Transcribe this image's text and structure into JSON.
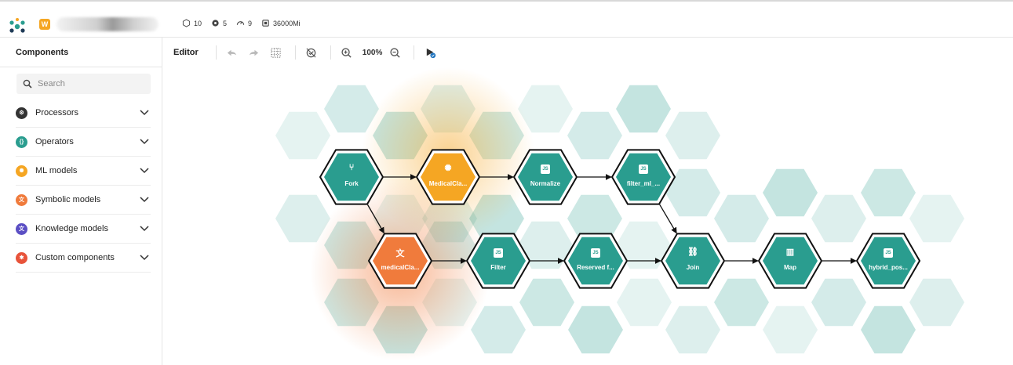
{
  "topbar": {
    "workspace_badge": "W",
    "stats": [
      {
        "icon": "hexagon-outline-icon",
        "value": "10"
      },
      {
        "icon": "gear-icon",
        "value": "5"
      },
      {
        "icon": "gauge-icon",
        "value": "9"
      },
      {
        "icon": "chip-icon",
        "value": "36000Mi"
      }
    ]
  },
  "sidebar": {
    "title": "Components",
    "search_placeholder": "Search",
    "categories": [
      {
        "label": "Processors",
        "color": "#333333",
        "icon": "gear-icon"
      },
      {
        "label": "Operators",
        "color": "#2a9d8f",
        "icon": "braces-icon"
      },
      {
        "label": "ML models",
        "color": "#f5a623",
        "icon": "brain-icon"
      },
      {
        "label": "Symbolic models",
        "color": "#f07b3c",
        "icon": "translate-icon"
      },
      {
        "label": "Knowledge models",
        "color": "#5b4fc4",
        "icon": "translate-icon"
      },
      {
        "label": "Custom components",
        "color": "#e8533a",
        "icon": "puzzle-icon"
      }
    ]
  },
  "toolbar": {
    "label": "Editor",
    "zoom": "100%"
  },
  "colors": {
    "teal": "#2a9d8f",
    "orange": "#f07b3c",
    "yellow": "#f5a623"
  },
  "graph": {
    "nodes": [
      {
        "id": "fork",
        "label": "Fork",
        "color": "teal",
        "icon": "fork-icon"
      },
      {
        "id": "medicalcla1",
        "label": "MedicalCla...",
        "color": "yellow",
        "icon": "brain-icon"
      },
      {
        "id": "normalize",
        "label": "Normalize",
        "color": "teal",
        "icon": "js-icon"
      },
      {
        "id": "filterml",
        "label": "filter_ml_...",
        "color": "teal",
        "icon": "js-icon"
      },
      {
        "id": "medicalcla2",
        "label": "medicalCla...",
        "color": "orange",
        "icon": "translate-icon"
      },
      {
        "id": "filter",
        "label": "Filter",
        "color": "teal",
        "icon": "js-icon"
      },
      {
        "id": "reserved",
        "label": "Reserved f...",
        "color": "teal",
        "icon": "js-icon"
      },
      {
        "id": "join",
        "label": "Join",
        "color": "teal",
        "icon": "link-icon"
      },
      {
        "id": "map",
        "label": "Map",
        "color": "teal",
        "icon": "map-icon"
      },
      {
        "id": "hybrid",
        "label": "hybrid_pos...",
        "color": "teal",
        "icon": "js-icon"
      }
    ],
    "edges": [
      [
        "fork",
        "medicalcla1"
      ],
      [
        "medicalcla1",
        "normalize"
      ],
      [
        "normalize",
        "filterml"
      ],
      [
        "fork",
        "medicalcla2"
      ],
      [
        "medicalcla2",
        "filter"
      ],
      [
        "filter",
        "reserved"
      ],
      [
        "reserved",
        "join"
      ],
      [
        "filterml",
        "join"
      ],
      [
        "join",
        "map"
      ],
      [
        "map",
        "hybrid"
      ]
    ]
  }
}
